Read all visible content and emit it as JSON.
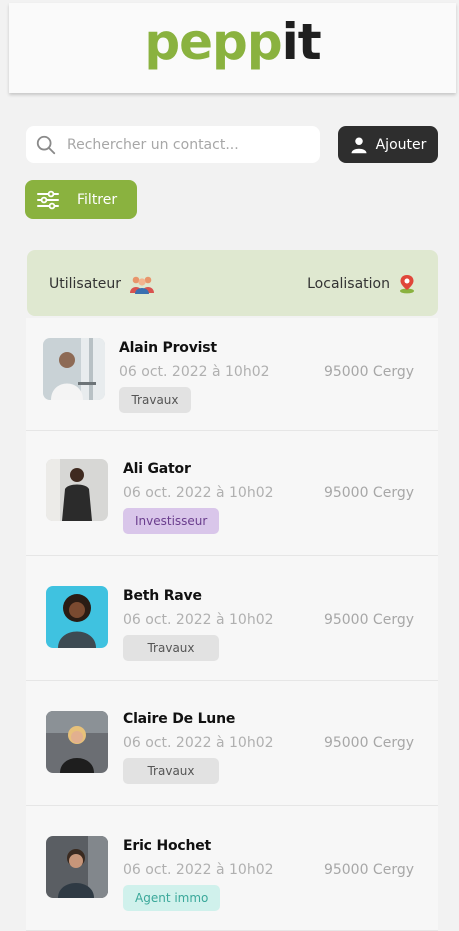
{
  "brand": {
    "logo_part1": "pep",
    "logo_part2": "p",
    "logo_part3": "it",
    "accent": "#8ab23f"
  },
  "search": {
    "placeholder": "Rechercher un contact..."
  },
  "toolbar": {
    "add_label": "Ajouter",
    "filter_label": "Filtrer"
  },
  "table": {
    "col_user": "Utilisateur",
    "col_location": "Localisation",
    "rows": [
      {
        "name": "Alain Provist",
        "date": "06 oct. 2022 à 10h02",
        "city": "95000 Cergy",
        "tag": "Travaux",
        "tag_color": "gray"
      },
      {
        "name": "Ali Gator",
        "date": "06 oct. 2022 à 10h02",
        "city": "95000 Cergy",
        "tag": "Investisseur",
        "tag_color": "purple"
      },
      {
        "name": "Beth Rave",
        "date": "06 oct. 2022 à 10h02",
        "city": "95000 Cergy",
        "tag": "Travaux",
        "tag_color": "gray"
      },
      {
        "name": "Claire De Lune",
        "date": "06 oct. 2022 à 10h02",
        "city": "95000 Cergy",
        "tag": "Travaux",
        "tag_color": "gray"
      },
      {
        "name": "Eric Hochet",
        "date": "06 oct. 2022 à 10h02",
        "city": "95000 Cergy",
        "tag": "Agent immo",
        "tag_color": "teal"
      }
    ]
  }
}
